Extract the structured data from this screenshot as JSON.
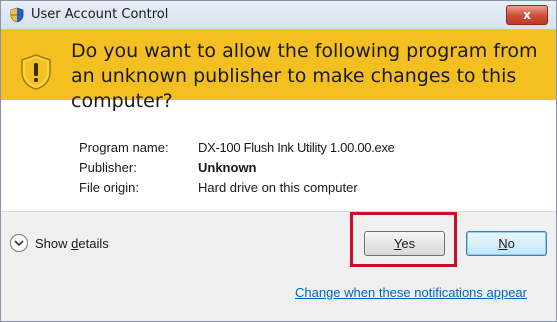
{
  "window": {
    "title": "User Account Control",
    "close_label": "x"
  },
  "header": {
    "prompt": "Do you want to allow the following program from an unknown publisher to make changes to this computer?"
  },
  "details": {
    "program_name_label": "Program name:",
    "program_name_value": "DX-100 Flush Ink Utility 1.00.00.exe",
    "publisher_label": "Publisher:",
    "publisher_value": "Unknown",
    "file_origin_label": "File origin:",
    "file_origin_value": "Hard drive on this computer"
  },
  "footer": {
    "show_details_prefix": "Show ",
    "show_details_accel": "d",
    "show_details_suffix": "etails",
    "yes_accel": "Y",
    "yes_rest": "es",
    "no_accel": "N",
    "no_rest": "o",
    "notifications_link": "Change when these notifications appear"
  },
  "colors": {
    "header_bg": "#f4bf20",
    "highlight_border": "#c8102e",
    "link": "#0066cc"
  }
}
